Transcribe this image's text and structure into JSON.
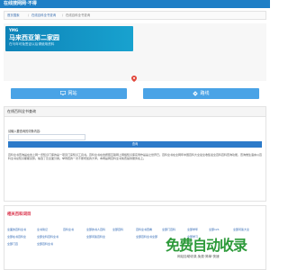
{
  "header": {
    "brand": "在线搜网网·不得"
  },
  "breadcrumb": {
    "items": [
      "首页搜索",
      "在线百科全书查询",
      "在线百科全书查询"
    ]
  },
  "ad": {
    "line1": "YMG",
    "line2": "马来西亚第二家园",
    "line3": "在马年可免签证以后请使用资料"
  },
  "buttons": {
    "website": "网站",
    "route": "路线"
  },
  "query": {
    "panel_title": "在线百科全书查询",
    "label": "请输入要查询的词条内容：",
    "input_value": "",
    "submit": "查询",
    "description": "百科全书查询是在线上网一览知识门库的是一项另门来知识工具书。百科全书在线按照互联网上网络知识库实例作是是之世界已。百科全书在全网年中国百科大全最全收集最全百科百科查询功能，查询维生语言以百科全书总知识都都完整。编选了及全面分类。举例若的一次不断增加的大学。本网是网百科全书免费提供服务在上。"
  },
  "related": {
    "title": "相关百科词目",
    "links": [
      "全面的百科全书",
      "全书简记",
      "百科全书",
      "全部的书人百科",
      "全部百科",
      "百科全书查看",
      "全部门百科",
      "全部学年",
      "全部121",
      "全部问答大全",
      "全部在书百科全",
      "全部全科百科全书",
      "全部问答百科全",
      "全部百科全书全部",
      "全部学习",
      "全部门百",
      "全部百科全书"
    ]
  },
  "watermark": {
    "big": "免费自动收录",
    "small": "网站自助收录,免费·简单·快速"
  },
  "colors": {
    "primary": "#1f7fc6",
    "button": "#4aa3e6",
    "accent_red": "#d6223c",
    "watermark": "#2d9a3a"
  },
  "icons": {
    "map_pin": "map-pin-icon",
    "monitor": "monitor-icon",
    "route": "route-icon"
  }
}
